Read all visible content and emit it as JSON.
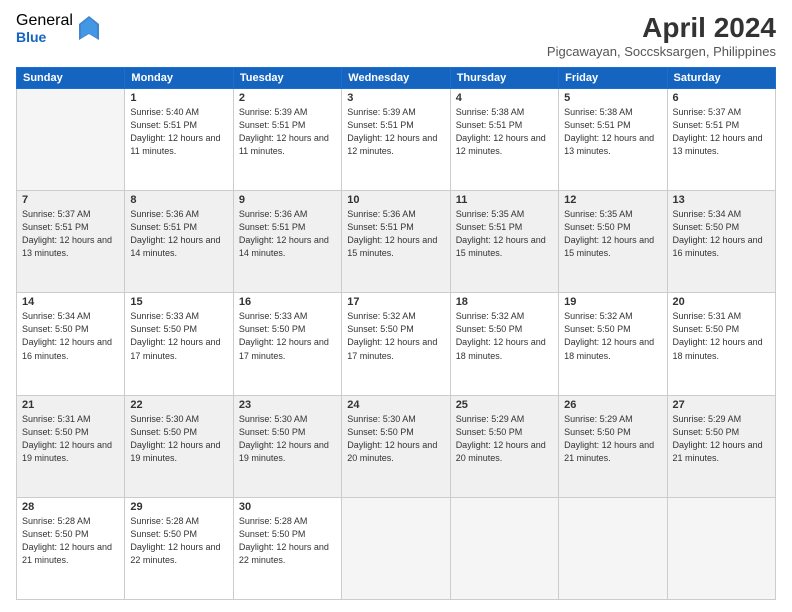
{
  "logo": {
    "general": "General",
    "blue": "Blue"
  },
  "title": "April 2024",
  "subtitle": "Pigcawayan, Soccsksargen, Philippines",
  "header_days": [
    "Sunday",
    "Monday",
    "Tuesday",
    "Wednesday",
    "Thursday",
    "Friday",
    "Saturday"
  ],
  "weeks": [
    [
      {
        "day": "",
        "sunrise": "",
        "sunset": "",
        "daylight": "",
        "empty": true
      },
      {
        "day": "1",
        "sunrise": "Sunrise: 5:40 AM",
        "sunset": "Sunset: 5:51 PM",
        "daylight": "Daylight: 12 hours and 11 minutes."
      },
      {
        "day": "2",
        "sunrise": "Sunrise: 5:39 AM",
        "sunset": "Sunset: 5:51 PM",
        "daylight": "Daylight: 12 hours and 11 minutes."
      },
      {
        "day": "3",
        "sunrise": "Sunrise: 5:39 AM",
        "sunset": "Sunset: 5:51 PM",
        "daylight": "Daylight: 12 hours and 12 minutes."
      },
      {
        "day": "4",
        "sunrise": "Sunrise: 5:38 AM",
        "sunset": "Sunset: 5:51 PM",
        "daylight": "Daylight: 12 hours and 12 minutes."
      },
      {
        "day": "5",
        "sunrise": "Sunrise: 5:38 AM",
        "sunset": "Sunset: 5:51 PM",
        "daylight": "Daylight: 12 hours and 13 minutes."
      },
      {
        "day": "6",
        "sunrise": "Sunrise: 5:37 AM",
        "sunset": "Sunset: 5:51 PM",
        "daylight": "Daylight: 12 hours and 13 minutes."
      }
    ],
    [
      {
        "day": "7",
        "sunrise": "Sunrise: 5:37 AM",
        "sunset": "Sunset: 5:51 PM",
        "daylight": "Daylight: 12 hours and 13 minutes."
      },
      {
        "day": "8",
        "sunrise": "Sunrise: 5:36 AM",
        "sunset": "Sunset: 5:51 PM",
        "daylight": "Daylight: 12 hours and 14 minutes."
      },
      {
        "day": "9",
        "sunrise": "Sunrise: 5:36 AM",
        "sunset": "Sunset: 5:51 PM",
        "daylight": "Daylight: 12 hours and 14 minutes."
      },
      {
        "day": "10",
        "sunrise": "Sunrise: 5:36 AM",
        "sunset": "Sunset: 5:51 PM",
        "daylight": "Daylight: 12 hours and 15 minutes."
      },
      {
        "day": "11",
        "sunrise": "Sunrise: 5:35 AM",
        "sunset": "Sunset: 5:51 PM",
        "daylight": "Daylight: 12 hours and 15 minutes."
      },
      {
        "day": "12",
        "sunrise": "Sunrise: 5:35 AM",
        "sunset": "Sunset: 5:50 PM",
        "daylight": "Daylight: 12 hours and 15 minutes."
      },
      {
        "day": "13",
        "sunrise": "Sunrise: 5:34 AM",
        "sunset": "Sunset: 5:50 PM",
        "daylight": "Daylight: 12 hours and 16 minutes."
      }
    ],
    [
      {
        "day": "14",
        "sunrise": "Sunrise: 5:34 AM",
        "sunset": "Sunset: 5:50 PM",
        "daylight": "Daylight: 12 hours and 16 minutes."
      },
      {
        "day": "15",
        "sunrise": "Sunrise: 5:33 AM",
        "sunset": "Sunset: 5:50 PM",
        "daylight": "Daylight: 12 hours and 17 minutes."
      },
      {
        "day": "16",
        "sunrise": "Sunrise: 5:33 AM",
        "sunset": "Sunset: 5:50 PM",
        "daylight": "Daylight: 12 hours and 17 minutes."
      },
      {
        "day": "17",
        "sunrise": "Sunrise: 5:32 AM",
        "sunset": "Sunset: 5:50 PM",
        "daylight": "Daylight: 12 hours and 17 minutes."
      },
      {
        "day": "18",
        "sunrise": "Sunrise: 5:32 AM",
        "sunset": "Sunset: 5:50 PM",
        "daylight": "Daylight: 12 hours and 18 minutes."
      },
      {
        "day": "19",
        "sunrise": "Sunrise: 5:32 AM",
        "sunset": "Sunset: 5:50 PM",
        "daylight": "Daylight: 12 hours and 18 minutes."
      },
      {
        "day": "20",
        "sunrise": "Sunrise: 5:31 AM",
        "sunset": "Sunset: 5:50 PM",
        "daylight": "Daylight: 12 hours and 18 minutes."
      }
    ],
    [
      {
        "day": "21",
        "sunrise": "Sunrise: 5:31 AM",
        "sunset": "Sunset: 5:50 PM",
        "daylight": "Daylight: 12 hours and 19 minutes."
      },
      {
        "day": "22",
        "sunrise": "Sunrise: 5:30 AM",
        "sunset": "Sunset: 5:50 PM",
        "daylight": "Daylight: 12 hours and 19 minutes."
      },
      {
        "day": "23",
        "sunrise": "Sunrise: 5:30 AM",
        "sunset": "Sunset: 5:50 PM",
        "daylight": "Daylight: 12 hours and 19 minutes."
      },
      {
        "day": "24",
        "sunrise": "Sunrise: 5:30 AM",
        "sunset": "Sunset: 5:50 PM",
        "daylight": "Daylight: 12 hours and 20 minutes."
      },
      {
        "day": "25",
        "sunrise": "Sunrise: 5:29 AM",
        "sunset": "Sunset: 5:50 PM",
        "daylight": "Daylight: 12 hours and 20 minutes."
      },
      {
        "day": "26",
        "sunrise": "Sunrise: 5:29 AM",
        "sunset": "Sunset: 5:50 PM",
        "daylight": "Daylight: 12 hours and 21 minutes."
      },
      {
        "day": "27",
        "sunrise": "Sunrise: 5:29 AM",
        "sunset": "Sunset: 5:50 PM",
        "daylight": "Daylight: 12 hours and 21 minutes."
      }
    ],
    [
      {
        "day": "28",
        "sunrise": "Sunrise: 5:28 AM",
        "sunset": "Sunset: 5:50 PM",
        "daylight": "Daylight: 12 hours and 21 minutes."
      },
      {
        "day": "29",
        "sunrise": "Sunrise: 5:28 AM",
        "sunset": "Sunset: 5:50 PM",
        "daylight": "Daylight: 12 hours and 22 minutes."
      },
      {
        "day": "30",
        "sunrise": "Sunrise: 5:28 AM",
        "sunset": "Sunset: 5:50 PM",
        "daylight": "Daylight: 12 hours and 22 minutes."
      },
      {
        "day": "",
        "sunrise": "",
        "sunset": "",
        "daylight": "",
        "empty": true
      },
      {
        "day": "",
        "sunrise": "",
        "sunset": "",
        "daylight": "",
        "empty": true
      },
      {
        "day": "",
        "sunrise": "",
        "sunset": "",
        "daylight": "",
        "empty": true
      },
      {
        "day": "",
        "sunrise": "",
        "sunset": "",
        "daylight": "",
        "empty": true
      }
    ]
  ]
}
